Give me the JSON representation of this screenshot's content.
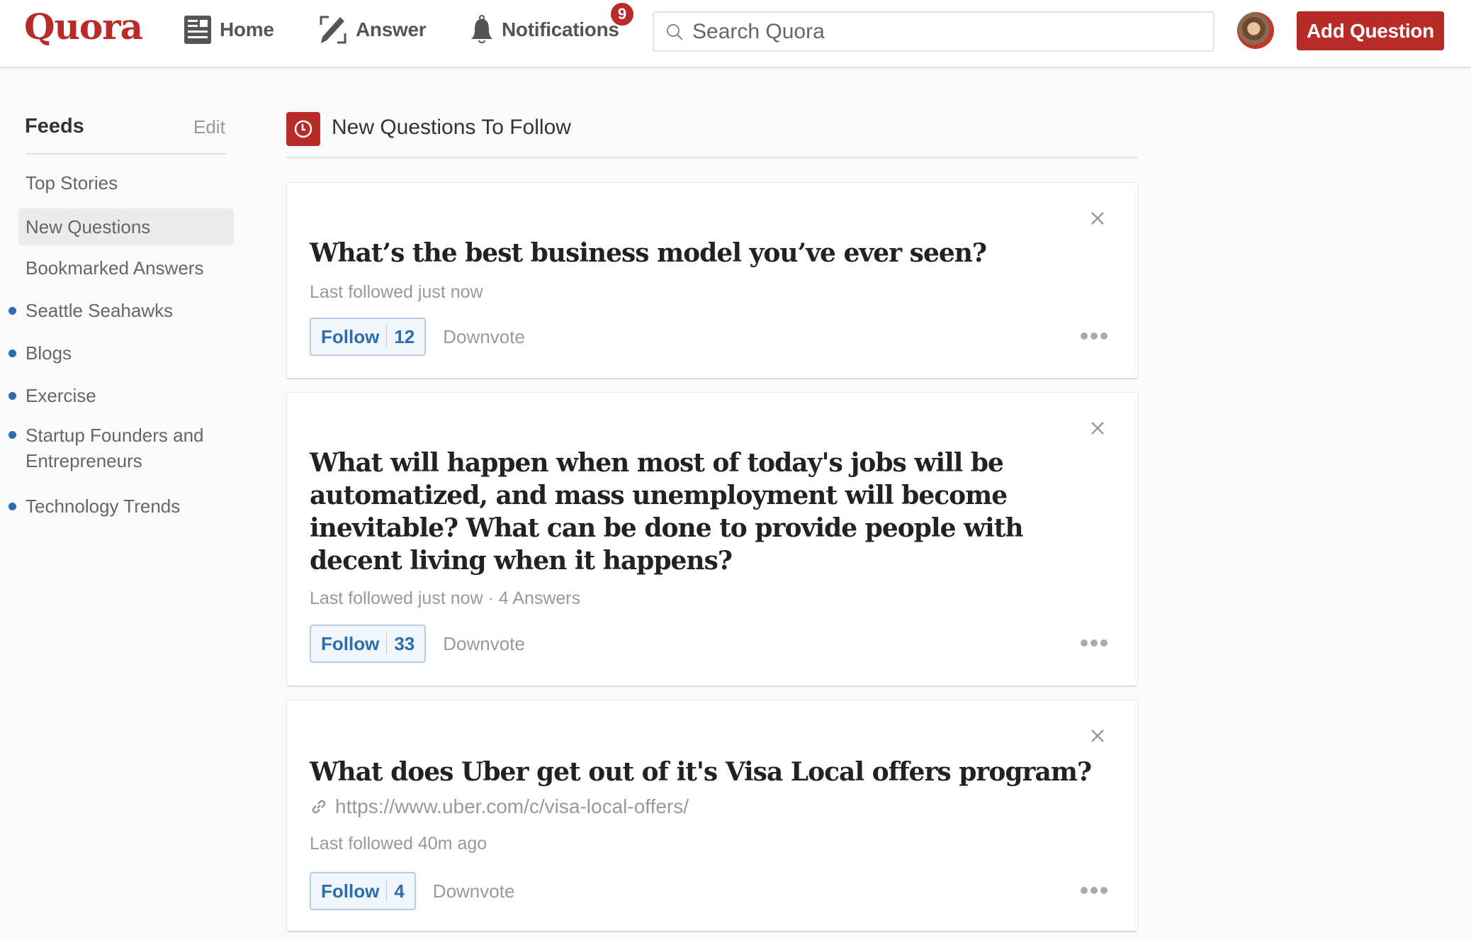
{
  "header": {
    "logo": "Quora",
    "nav": [
      {
        "label": "Home",
        "icon": "news-feed-icon"
      },
      {
        "label": "Answer",
        "icon": "pencil-edit-icon"
      },
      {
        "label": "Notifications",
        "icon": "bell-icon"
      }
    ],
    "notification_count": "9",
    "search_placeholder": "Search Quora",
    "add_question_label": "Add Question"
  },
  "sidebar": {
    "title": "Feeds",
    "edit_label": "Edit",
    "items": [
      {
        "label": "Top Stories",
        "dot": false,
        "active": false
      },
      {
        "label": "New Questions",
        "dot": false,
        "active": true
      },
      {
        "label": "Bookmarked Answers",
        "dot": false,
        "active": false
      },
      {
        "label": "Seattle Seahawks",
        "dot": true,
        "active": false
      },
      {
        "label": "Blogs",
        "dot": true,
        "active": false
      },
      {
        "label": "Exercise",
        "dot": true,
        "active": false
      },
      {
        "label": "Startup Founders and Entrepreneurs",
        "dot": true,
        "active": false
      },
      {
        "label": "Technology Trends",
        "dot": true,
        "active": false
      }
    ]
  },
  "main": {
    "title": "New Questions To Follow",
    "colors": {
      "brand": "#b92b27",
      "link_blue": "#2b6dad"
    },
    "questions": [
      {
        "title": "What’s the best business model you’ve ever seen?",
        "meta": "Last followed just now",
        "follow_label": "Follow",
        "follow_count": "12",
        "downvote_label": "Downvote"
      },
      {
        "title": "What will happen when most of today's jobs will be automatized, and mass unemployment will become inevitable? What can be done to provide people with decent living when it happens?",
        "meta": "Last followed just now · 4 Answers",
        "follow_label": "Follow",
        "follow_count": "33",
        "downvote_label": "Downvote"
      },
      {
        "title": "What does Uber get out of it's Visa Local offers program?",
        "link": "https://www.uber.com/c/visa-local-offers/",
        "meta": "Last followed 40m ago",
        "follow_label": "Follow",
        "follow_count": "4",
        "downvote_label": "Downvote"
      }
    ]
  }
}
